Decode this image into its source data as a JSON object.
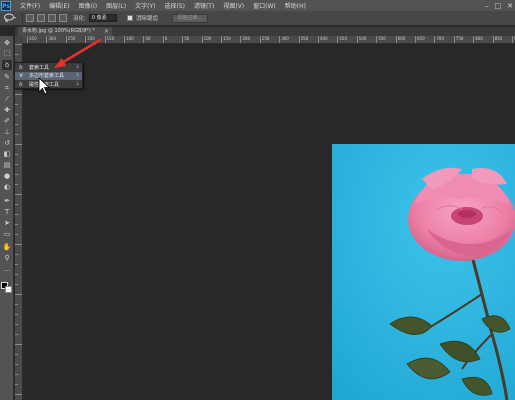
{
  "app": {
    "logo": "Ps"
  },
  "menubar": {
    "items": [
      "文件(F)",
      "编辑(E)",
      "图像(I)",
      "图层(L)",
      "文字(Y)",
      "选择(S)",
      "滤镜(T)",
      "视图(V)",
      "窗口(W)",
      "帮助(H)"
    ],
    "window_controls": [
      "–",
      "□",
      "✕"
    ]
  },
  "options": {
    "feather_label": "羽化:",
    "feather_value": "0 像素",
    "antialias_label": "消除锯齿",
    "refine_edge": "调整边缘..."
  },
  "document": {
    "tab_title": "青水粉.jpg @ 100%(RGB/8*) *",
    "close_glyph": "×"
  },
  "ruler": {
    "h_labels": [
      "350",
      "300",
      "250",
      "200",
      "150",
      "100",
      "50",
      "0",
      "50",
      "100",
      "150",
      "200",
      "250",
      "300",
      "350",
      "400",
      "450",
      "500",
      "550",
      "600",
      "650",
      "700",
      "750",
      "800",
      "850",
      "900"
    ]
  },
  "tools": [
    {
      "icon": "move-icon",
      "glyph": "✥"
    },
    {
      "icon": "marquee-icon",
      "glyph": "⬚"
    },
    {
      "icon": "lasso-icon",
      "glyph": "ꝺ"
    },
    {
      "icon": "quick-select-icon",
      "glyph": "✎"
    },
    {
      "icon": "crop-icon",
      "glyph": "⌗"
    },
    {
      "icon": "eyedropper-icon",
      "glyph": "⁄"
    },
    {
      "icon": "healing-icon",
      "glyph": "✚"
    },
    {
      "icon": "brush-icon",
      "glyph": "✐"
    },
    {
      "icon": "stamp-icon",
      "glyph": "⊥"
    },
    {
      "icon": "history-brush-icon",
      "glyph": "↺"
    },
    {
      "icon": "eraser-icon",
      "glyph": "◧"
    },
    {
      "icon": "gradient-icon",
      "glyph": "▤"
    },
    {
      "icon": "blur-icon",
      "glyph": "●"
    },
    {
      "icon": "dodge-icon",
      "glyph": "◐"
    },
    {
      "icon": "pen-icon",
      "glyph": "✒"
    },
    {
      "icon": "type-icon",
      "glyph": "T"
    },
    {
      "icon": "path-select-icon",
      "glyph": "➤"
    },
    {
      "icon": "shape-icon",
      "glyph": "▭"
    },
    {
      "icon": "hand-icon",
      "glyph": "✋"
    },
    {
      "icon": "zoom-icon",
      "glyph": "⚲"
    },
    {
      "icon": "edit-toolbar-icon",
      "glyph": "…"
    }
  ],
  "flyout": {
    "items": [
      {
        "icon": "lasso-icon",
        "glyph": "ꝺ",
        "label": "套索工具",
        "key": "L"
      },
      {
        "icon": "polygonal-lasso-icon",
        "glyph": "⋎",
        "label": "多边形套索工具",
        "key": "L"
      },
      {
        "icon": "magnetic-lasso-icon",
        "glyph": "ꝺ",
        "label": "磁性套索工具",
        "key": "L"
      }
    ]
  },
  "colors": {
    "canvas_bg": "#282828",
    "image_bg": "#28b3df",
    "arrow": "#e8302a",
    "petal": "#ec7fa6",
    "leaf": "#44552c"
  }
}
